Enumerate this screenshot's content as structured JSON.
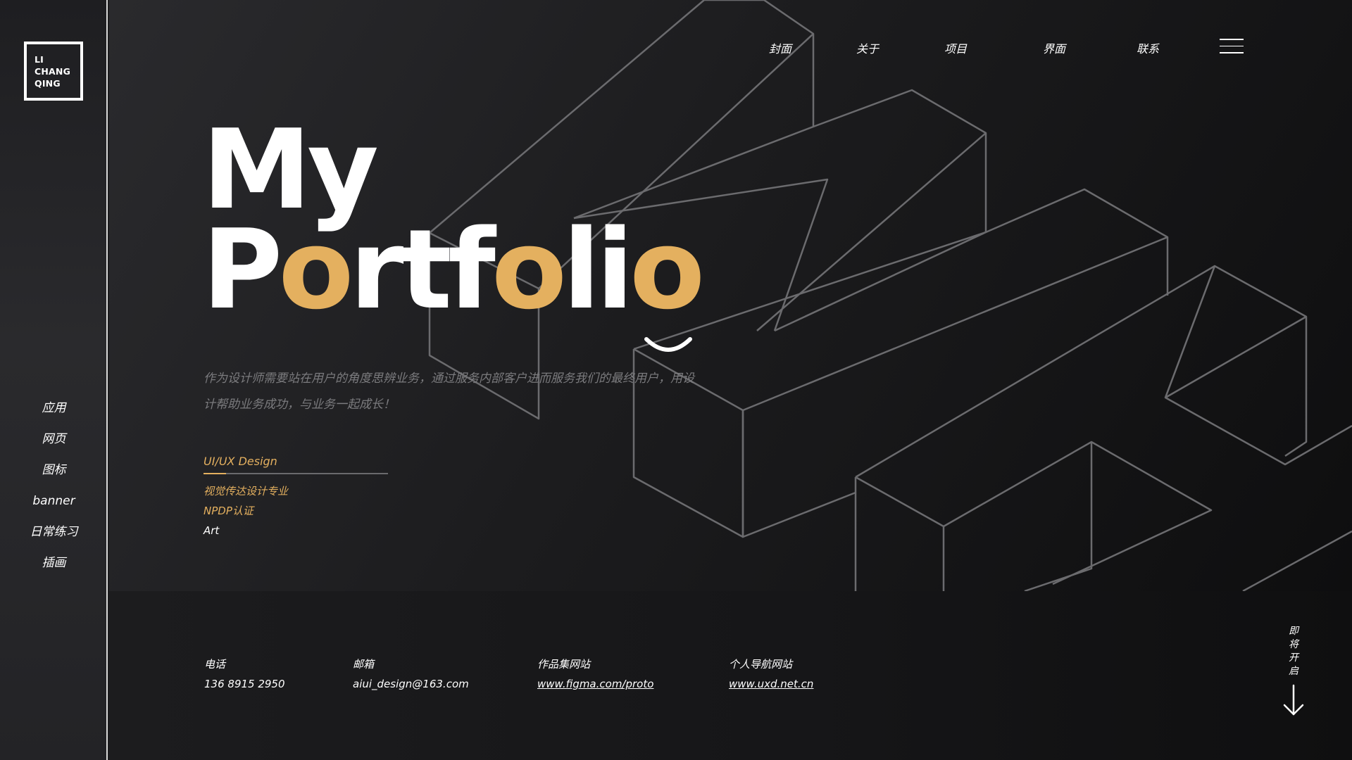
{
  "logo": {
    "line1": "LI",
    "line2": "CHANG",
    "line3": "QING"
  },
  "side_nav": [
    {
      "label": "应用"
    },
    {
      "label": "网页"
    },
    {
      "label": "图标"
    },
    {
      "label": "banner"
    },
    {
      "label": "日常练习"
    },
    {
      "label": "插画"
    }
  ],
  "top_nav": [
    {
      "label": "封面"
    },
    {
      "label": "关于"
    },
    {
      "label": "项目"
    },
    {
      "label": "界面"
    },
    {
      "label": "联系"
    }
  ],
  "hero": {
    "title_line1": "My",
    "title_line2_parts": [
      "P",
      "o",
      "rtf",
      "o",
      "li",
      "o"
    ],
    "intro": "作为设计师需要站在用户的角度思辨业务，通过服务内部客户进而服务我们的最终用户，用设计帮助业务成功，与业务一起成长！",
    "accent_color": "#e4b05f"
  },
  "skills": {
    "heading": "UI/UX Design",
    "items": [
      "视觉传达设计专业",
      "NPDP认证",
      "Art"
    ]
  },
  "contacts": [
    {
      "label": "电话",
      "value": "136 8915 2950"
    },
    {
      "label": "邮箱",
      "value": "aiui_design@163.com"
    },
    {
      "label": "作品集网站",
      "value": "www.figma.com/proto"
    },
    {
      "label": "个人导航网站",
      "value": "www.uxd.net.cn"
    }
  ],
  "scroll_hint": {
    "chars": [
      "即",
      "将",
      "开",
      "启"
    ]
  },
  "icons": {
    "menu": "hamburger-menu-icon",
    "arrow": "arrow-down-icon",
    "smile": "smile-icon"
  }
}
